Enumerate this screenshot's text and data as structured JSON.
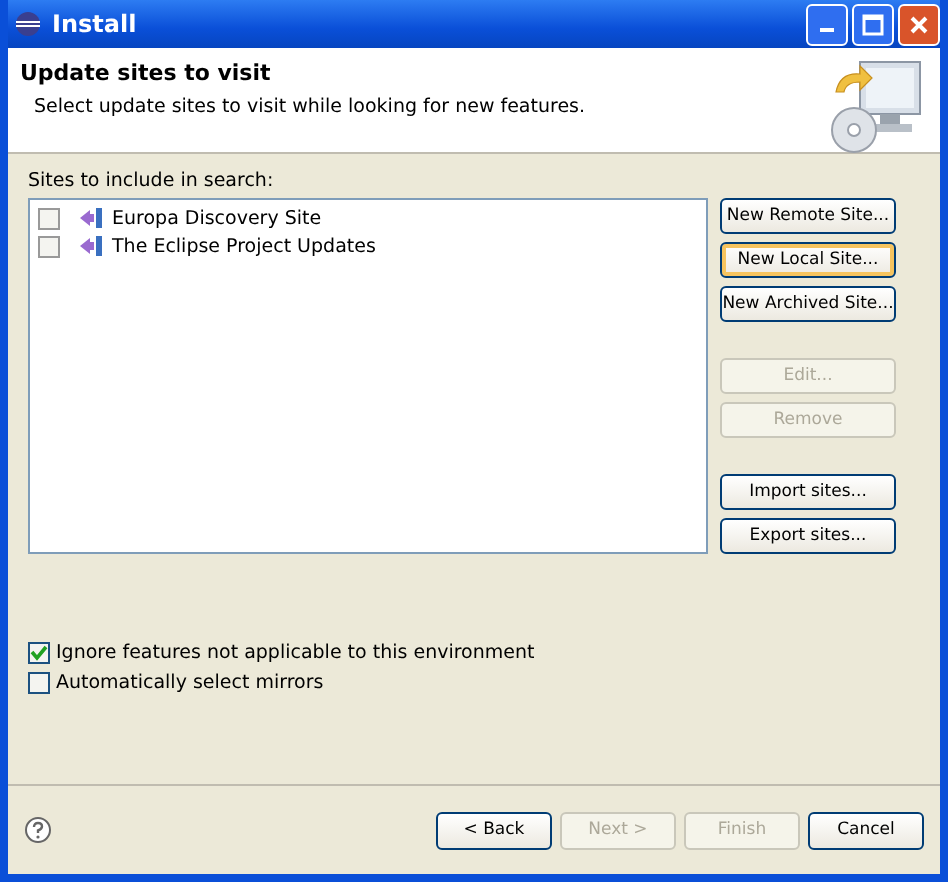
{
  "window": {
    "title": "Install"
  },
  "header": {
    "title": "Update sites to visit",
    "description": "Select update sites to visit while looking for new features."
  },
  "sites": {
    "label": "Sites to include in search:",
    "items": [
      {
        "name": "Europa Discovery Site",
        "checked": false
      },
      {
        "name": "The Eclipse Project Updates",
        "checked": false
      }
    ]
  },
  "side_buttons": [
    {
      "label": "New Remote Site...",
      "disabled": false,
      "focused": false
    },
    {
      "label": "New Local Site...",
      "disabled": false,
      "focused": true
    },
    {
      "label": "New Archived Site...",
      "disabled": false,
      "focused": false
    },
    {
      "label": "Edit...",
      "disabled": true,
      "focused": false
    },
    {
      "label": "Remove",
      "disabled": true,
      "focused": false
    },
    {
      "label": "Import sites...",
      "disabled": false,
      "focused": false
    },
    {
      "label": "Export sites...",
      "disabled": false,
      "focused": false
    }
  ],
  "options": [
    {
      "label": "Ignore features not applicable to this environment",
      "checked": true
    },
    {
      "label": "Automatically select mirrors",
      "checked": false
    }
  ],
  "footer_buttons": [
    {
      "label": "< Back",
      "disabled": false
    },
    {
      "label": "Next >",
      "disabled": true
    },
    {
      "label": "Finish",
      "disabled": true
    },
    {
      "label": "Cancel",
      "disabled": false
    }
  ]
}
